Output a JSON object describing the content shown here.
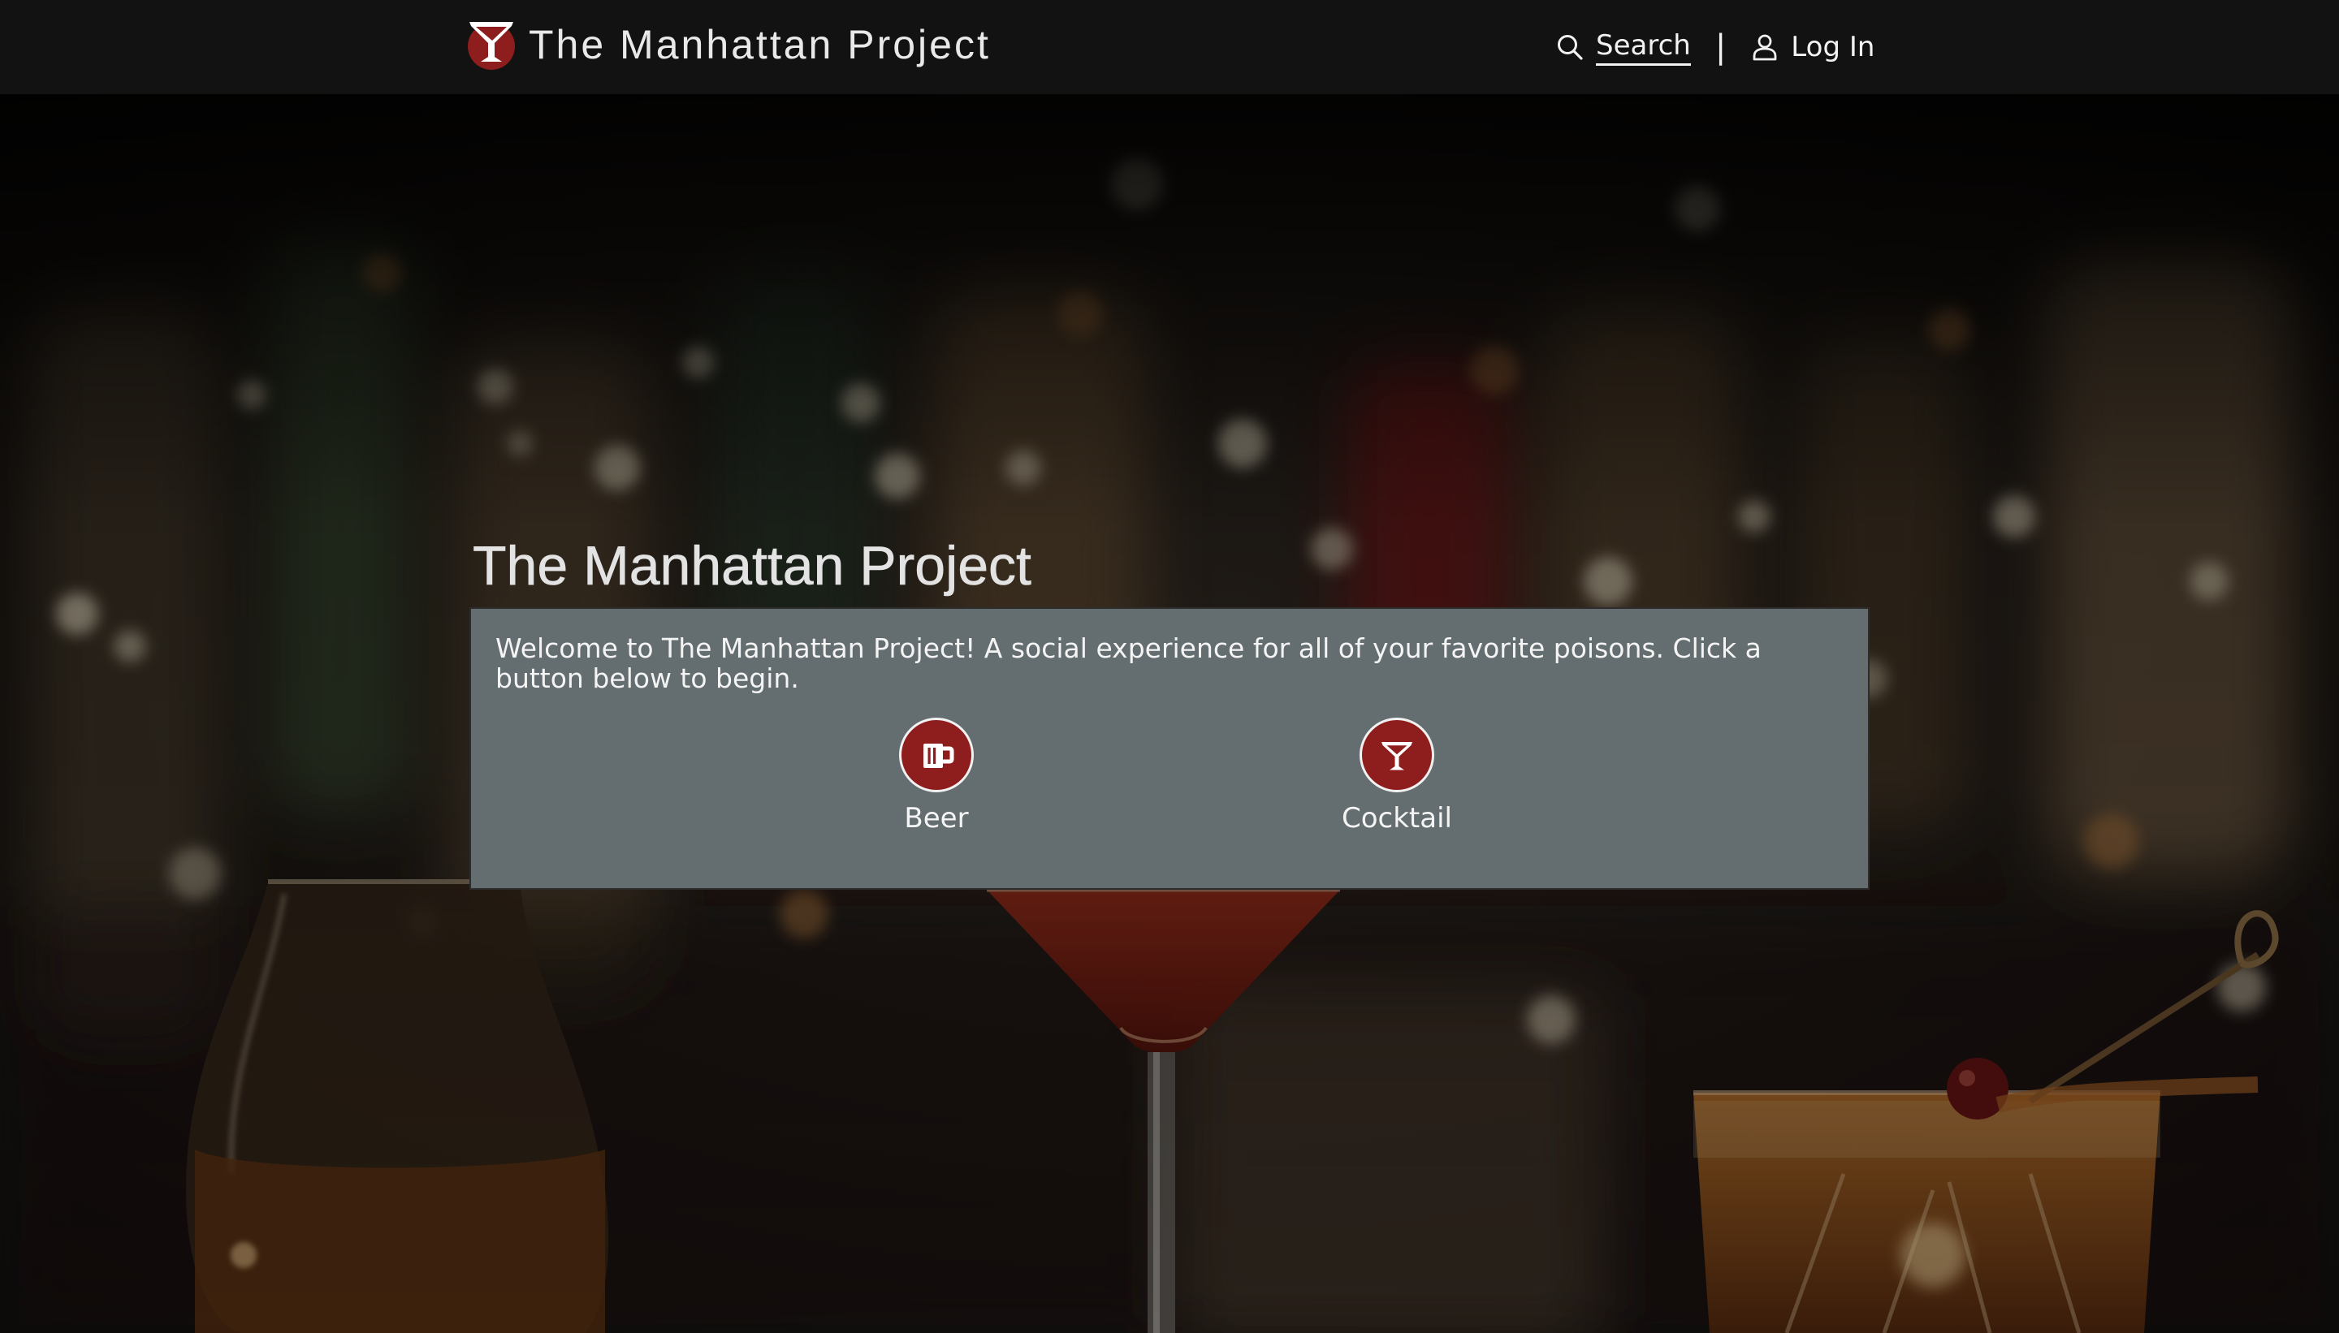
{
  "navbar": {
    "brand_title": "The Manhattan Project",
    "search_label": "Search",
    "separator": "|",
    "login_label": "Log In"
  },
  "hero": {
    "title": "The Manhattan Project",
    "welcome_text": "Welcome to The Manhattan Project! A social experience for all of your favorite poisons. Click a button below to begin.",
    "choices": [
      {
        "label": "Beer",
        "icon": "beer-mug-icon"
      },
      {
        "label": "Cocktail",
        "icon": "cocktail-glass-icon"
      }
    ]
  },
  "colors": {
    "navbar_bg": "#121212",
    "panel_bg": "#646d70",
    "accent_red": "#8e1d1d",
    "text_light": "#f2f2f2"
  }
}
